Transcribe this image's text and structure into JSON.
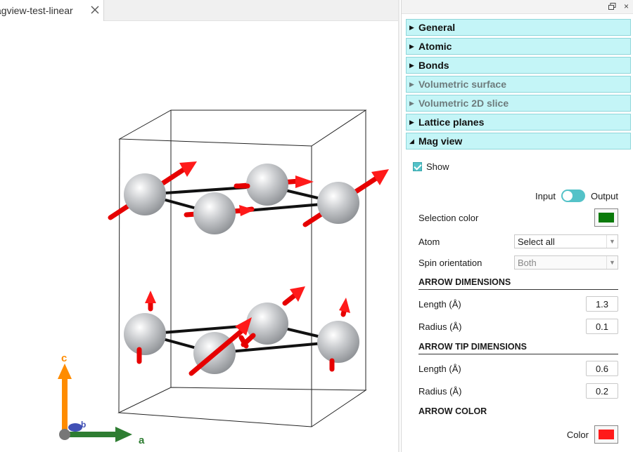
{
  "tab": {
    "title": "agview-test-linear"
  },
  "viewport": {
    "axes": {
      "c_label": "c",
      "a_label": "a",
      "b_label": "b"
    },
    "colors": {
      "atom": "#c7c9cc",
      "bond": "#111111",
      "spin": "#ff1a1a",
      "axis_c": "#ff8c00",
      "axis_a": "#2e7d32",
      "axis_b": "#4050b5",
      "cell": "#222222"
    }
  },
  "panel": {
    "sections": [
      {
        "label": "General",
        "expanded": false,
        "disabled": false
      },
      {
        "label": "Atomic",
        "expanded": false,
        "disabled": false
      },
      {
        "label": "Bonds",
        "expanded": false,
        "disabled": false
      },
      {
        "label": "Volumetric surface",
        "expanded": false,
        "disabled": true
      },
      {
        "label": "Volumetric 2D slice",
        "expanded": false,
        "disabled": true
      },
      {
        "label": "Lattice planes",
        "expanded": false,
        "disabled": false
      },
      {
        "label": "Mag view",
        "expanded": true,
        "disabled": false
      }
    ],
    "mag": {
      "show_label": "Show",
      "show_checked": true,
      "input_label": "Input",
      "output_label": "Output",
      "selection_color_label": "Selection color",
      "selection_color": "#0a7a0a",
      "atom_label": "Atom",
      "atom_value": "Select all",
      "spin_label": "Spin orientation",
      "spin_value": "Both",
      "arrow_dim_heading": "ARROW DIMENSIONS",
      "length_label": "Length (Å)",
      "length_value": "1.3",
      "radius_label": "Radius (Å)",
      "radius_value": "0.1",
      "tip_heading": "ARROW TIP DIMENSIONS",
      "tip_length_label": "Length (Å)",
      "tip_length_value": "0.6",
      "tip_radius_label": "Radius (Å)",
      "tip_radius_value": "0.2",
      "color_heading": "ARROW COLOR",
      "color_label": "Color",
      "color_value": "#ff1a1a"
    }
  }
}
